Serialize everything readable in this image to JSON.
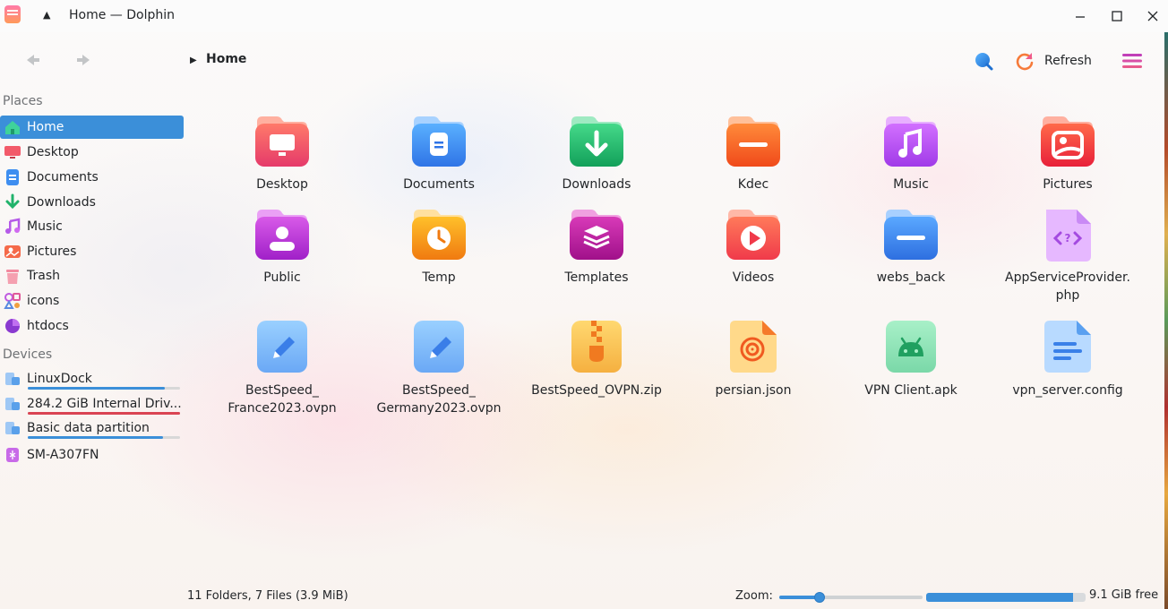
{
  "window": {
    "title": "Home — Dolphin"
  },
  "toolbar": {
    "breadcrumb": "Home",
    "refresh_label": "Refresh"
  },
  "sidebar": {
    "places_title": "Places",
    "places": [
      {
        "label": "Home",
        "icon": "home-icon",
        "active": true
      },
      {
        "label": "Desktop",
        "icon": "desktop-icon"
      },
      {
        "label": "Documents",
        "icon": "documents-icon"
      },
      {
        "label": "Downloads",
        "icon": "downloads-icon"
      },
      {
        "label": "Music",
        "icon": "music-icon"
      },
      {
        "label": "Pictures",
        "icon": "pictures-icon"
      },
      {
        "label": "Trash",
        "icon": "trash-icon"
      },
      {
        "label": "icons",
        "icon": "icons-folder-icon"
      },
      {
        "label": "htdocs",
        "icon": "htdocs-icon"
      }
    ],
    "devices_title": "Devices",
    "devices": [
      {
        "label": "LinuxDock",
        "icon": "drive-icon",
        "usage": 0.9,
        "bar_color": "#3b8fd9"
      },
      {
        "label": "284.2 GiB Internal Driv...",
        "icon": "drive-icon",
        "usage": 1.0,
        "bar_color": "#da4453"
      },
      {
        "label": "Basic data partition",
        "icon": "drive-icon",
        "usage": 0.89,
        "bar_color": "#3b8fd9"
      },
      {
        "label": "SM-A307FN",
        "icon": "phone-icon"
      }
    ]
  },
  "files": [
    {
      "label": "Desktop",
      "icon": "desktop-folder-icon"
    },
    {
      "label": "Documents",
      "icon": "documents-folder-icon"
    },
    {
      "label": "Downloads",
      "icon": "downloads-folder-icon"
    },
    {
      "label": "Kdec",
      "icon": "kdec-folder-icon"
    },
    {
      "label": "Music",
      "icon": "music-folder-icon"
    },
    {
      "label": "Pictures",
      "icon": "pictures-folder-icon"
    },
    {
      "label": "Public",
      "icon": "public-folder-icon"
    },
    {
      "label": "Temp",
      "icon": "temp-folder-icon"
    },
    {
      "label": "Templates",
      "icon": "templates-folder-icon"
    },
    {
      "label": "Videos",
      "icon": "videos-folder-icon"
    },
    {
      "label": "webs_back",
      "icon": "webs-back-folder-icon"
    },
    {
      "label": "AppServiceProvider.\nphp",
      "icon": "php-file-icon"
    },
    {
      "label": "BestSpeed_\nFrance2023.ovpn",
      "icon": "ovpn-file-icon"
    },
    {
      "label": "BestSpeed_\nGermany2023.ovpn",
      "icon": "ovpn-file-icon"
    },
    {
      "label": "BestSpeed_OVPN.zip",
      "icon": "zip-file-icon"
    },
    {
      "label": "persian.json",
      "icon": "json-file-icon"
    },
    {
      "label": "VPN Client.apk",
      "icon": "apk-file-icon"
    },
    {
      "label": "vpn_server.config",
      "icon": "config-file-icon"
    }
  ],
  "status": {
    "summary": "11 Folders, 7 Files (3.9 MiB)",
    "zoom_label": "Zoom:",
    "zoom_value": 0.28,
    "free_label": "9.1 GiB free",
    "disk_used": 0.92
  },
  "colors": {
    "accent": "#3b8fd9",
    "danger": "#da4453"
  }
}
